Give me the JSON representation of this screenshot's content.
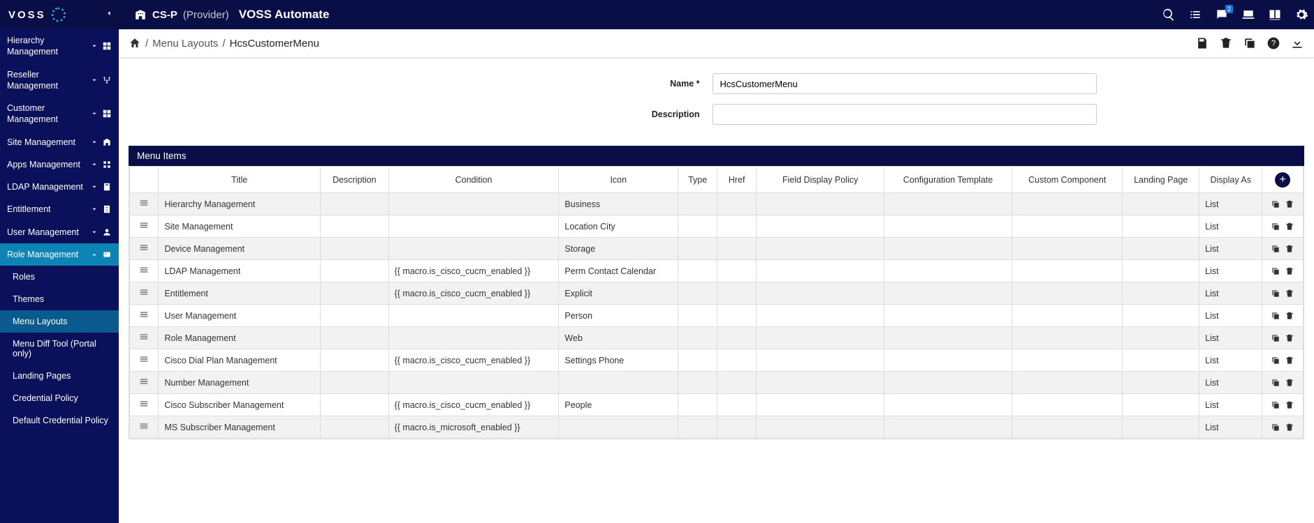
{
  "header": {
    "logo_text": "VOSS",
    "provider_code": "CS-P",
    "provider_paren": "(Provider)",
    "app_name": "VOSS Automate"
  },
  "sidebar": {
    "items": [
      {
        "label": "Hierarchy Management",
        "expanded": false
      },
      {
        "label": "Reseller Management",
        "expanded": false
      },
      {
        "label": "Customer Management",
        "expanded": false
      },
      {
        "label": "Site Management",
        "expanded": false
      },
      {
        "label": "Apps Management",
        "expanded": false
      },
      {
        "label": "LDAP Management",
        "expanded": false
      },
      {
        "label": "Entitlement",
        "expanded": false
      },
      {
        "label": "User Management",
        "expanded": false
      },
      {
        "label": "Role Management",
        "expanded": true
      }
    ],
    "subitems": [
      {
        "label": "Roles",
        "active": false
      },
      {
        "label": "Themes",
        "active": false
      },
      {
        "label": "Menu Layouts",
        "active": true
      },
      {
        "label": "Menu Diff Tool (Portal only)",
        "active": false
      },
      {
        "label": "Landing Pages",
        "active": false
      },
      {
        "label": "Credential Policy",
        "active": false
      },
      {
        "label": "Default Credential Policy",
        "active": false
      }
    ]
  },
  "breadcrumb": {
    "items": [
      "Menu Layouts",
      "HcsCustomerMenu"
    ]
  },
  "form": {
    "name_label": "Name",
    "description_label": "Description",
    "name_value": "HcsCustomerMenu",
    "description_value": ""
  },
  "section_title": "Menu Items",
  "columns": {
    "title": "Title",
    "description": "Description",
    "condition": "Condition",
    "icon": "Icon",
    "type": "Type",
    "href": "Href",
    "fdp": "Field Display Policy",
    "ct": "Configuration Template",
    "cc": "Custom Component",
    "lp": "Landing Page",
    "da": "Display As"
  },
  "rows": [
    {
      "title": "Hierarchy Management",
      "condition": "",
      "icon": "Business",
      "da": "List"
    },
    {
      "title": "Site Management",
      "condition": "",
      "icon": "Location City",
      "da": "List"
    },
    {
      "title": "Device Management",
      "condition": "",
      "icon": "Storage",
      "da": "List"
    },
    {
      "title": "LDAP Management",
      "condition": "{{ macro.is_cisco_cucm_enabled }}",
      "icon": "Perm Contact Calendar",
      "da": "List"
    },
    {
      "title": "Entitlement",
      "condition": "{{ macro.is_cisco_cucm_enabled }}",
      "icon": "Explicit",
      "da": "List"
    },
    {
      "title": "User Management",
      "condition": "",
      "icon": "Person",
      "da": "List"
    },
    {
      "title": "Role Management",
      "condition": "",
      "icon": "Web",
      "da": "List"
    },
    {
      "title": "Cisco Dial Plan Management",
      "condition": "{{ macro.is_cisco_cucm_enabled }}",
      "icon": "Settings Phone",
      "da": "List"
    },
    {
      "title": "Number Management",
      "condition": "",
      "icon": "",
      "da": "List"
    },
    {
      "title": "Cisco Subscriber Management",
      "condition": "{{ macro.is_cisco_cucm_enabled }}",
      "icon": "People",
      "da": "List"
    },
    {
      "title": "MS Subscriber Management",
      "condition": "{{ macro.is_microsoft_enabled }}",
      "icon": "",
      "da": "List"
    }
  ],
  "chat_badge": "2"
}
